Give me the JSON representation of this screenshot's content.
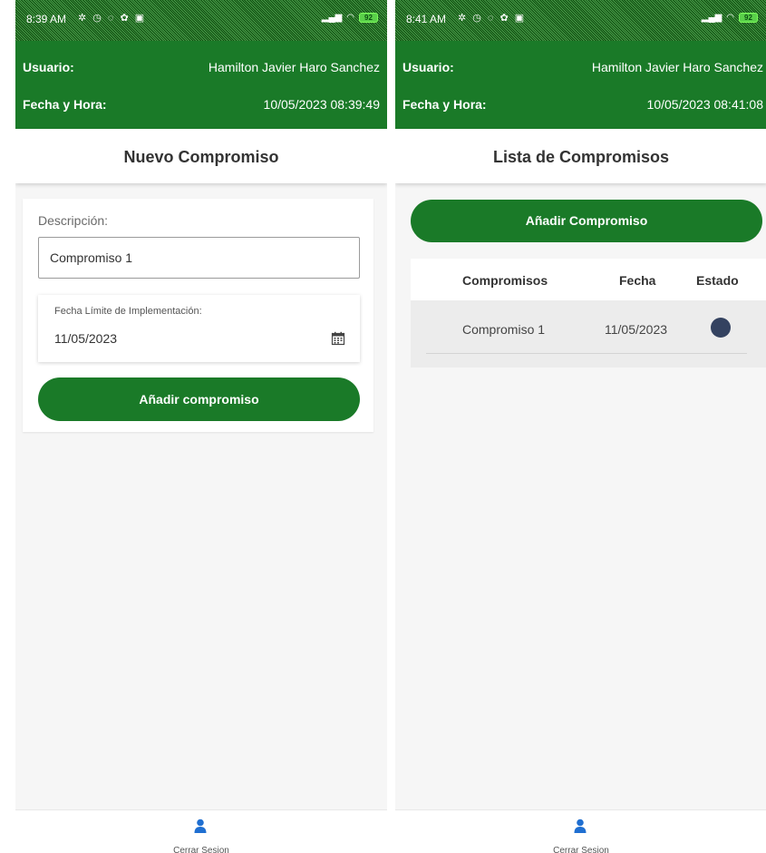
{
  "colors": {
    "header_green": "#1a7a28",
    "status_dot": "#344260",
    "user_icon": "#1f6fd1"
  },
  "left": {
    "status": {
      "time": "8:39 AM",
      "battery": "92"
    },
    "header": {
      "user_label": "Usuario:",
      "user_value": "Hamilton Javier Haro Sanchez",
      "date_label": "Fecha y Hora:",
      "date_value": "10/05/2023 08:39:49"
    },
    "title": "Nuevo Compromiso",
    "form": {
      "description_label": "Descripción:",
      "description_value": "Compromiso 1",
      "date_label": "Fecha Límite de Implementación:",
      "date_value": "11/05/2023",
      "submit_label": "Añadir compromiso"
    },
    "nav": {
      "logout_label": "Cerrar Sesion"
    }
  },
  "right": {
    "status": {
      "time": "8:41 AM",
      "battery": "92"
    },
    "header": {
      "user_label": "Usuario:",
      "user_value": "Hamilton Javier Haro Sanchez",
      "date_label": "Fecha y Hora:",
      "date_value": "10/05/2023 08:41:08"
    },
    "title": "Lista de Compromisos",
    "add_button_label": "Añadir Compromiso",
    "table": {
      "columns": [
        "Compromisos",
        "Fecha",
        "Estado"
      ],
      "rows": [
        {
          "compromiso": "Compromiso 1",
          "fecha": "11/05/2023",
          "estado": "dot"
        }
      ]
    },
    "nav": {
      "logout_label": "Cerrar Sesion"
    }
  },
  "icons": {
    "calendar": "calendar-icon",
    "user": "user-icon",
    "status_icons": "notification-icons",
    "signal": "signal-icon",
    "wifi": "wifi-icon",
    "battery": "battery-icon"
  }
}
